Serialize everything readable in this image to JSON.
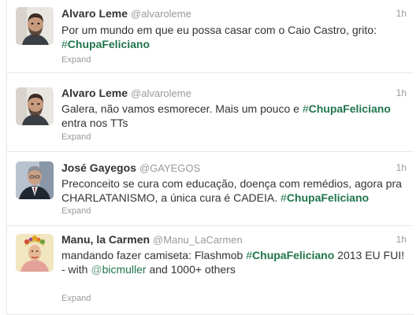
{
  "tweets": [
    {
      "fullname": "Alvaro Leme",
      "username": "@alvaroleme",
      "time": "1h",
      "text_1": "Por um mundo em que eu possa casar com o Caio Castro, grito:",
      "hashtag_1": "ChupaFeliciano",
      "expand": "Expand",
      "avatar_icon": "bearded-man-avatar"
    },
    {
      "fullname": "Alvaro Leme",
      "username": "@alvaroleme",
      "time": "1h",
      "text_1": "Galera, não vamos esmorecer. Mais um pouco e",
      "hashtag_1": "ChupaFeliciano",
      "text_2": "entra nos TTs",
      "expand": "Expand",
      "avatar_icon": "bearded-man-avatar"
    },
    {
      "fullname": "José Gayegos",
      "username": "@GAYEGOS",
      "time": "1h",
      "text_1": "Preconceito se cura com educação, doença com remédios, agora pra CHARLATANISMO, a única cura é CADEIA.",
      "hashtag_1": "ChupaFeliciano",
      "expand": "Expand",
      "avatar_icon": "man-suit-avatar"
    },
    {
      "fullname": "Manu, la Carmen",
      "username": "@Manu_LaCarmen",
      "time": "1h",
      "text_1": "mandando fazer camiseta: Flashmob",
      "hashtag_1": "ChupaFeliciano",
      "text_2": "2013 EU FUI!",
      "with_prefix": "- with",
      "mention": "bicmuller",
      "with_suffix": "and 1000+ others",
      "expand": "Expand",
      "avatar_icon": "woman-fruit-hat-avatar"
    }
  ],
  "symbols": {
    "hash": "#",
    "at": "@"
  },
  "colors": {
    "link": "#20754c",
    "name": "#333333",
    "meta": "#999999",
    "divider": "#e8e8e8"
  }
}
